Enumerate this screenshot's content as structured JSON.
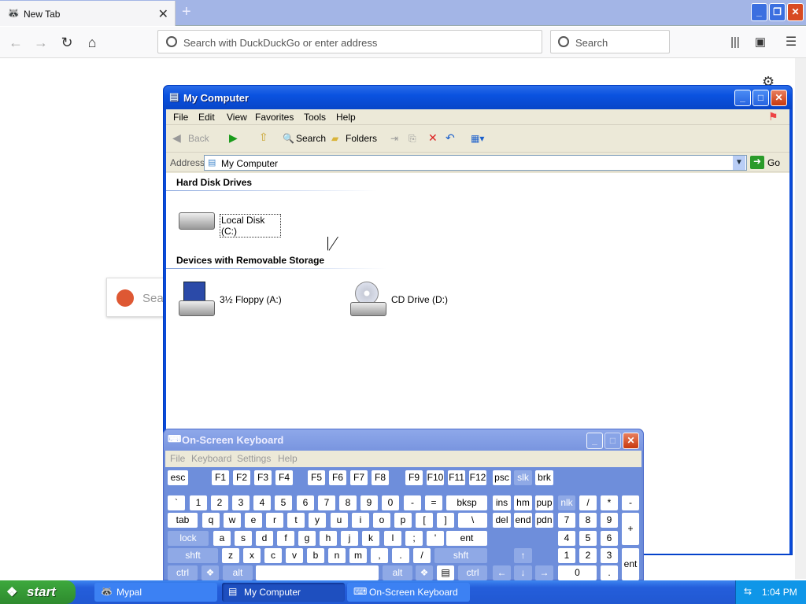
{
  "browser": {
    "tab_title": "New Tab",
    "url_placeholder": "Search with DuckDuckGo or enter address",
    "search_placeholder": "Search",
    "ddg_search_text": "Sea"
  },
  "mycomputer": {
    "title": "My Computer",
    "menu": [
      "File",
      "Edit",
      "View",
      "Favorites",
      "Tools",
      "Help"
    ],
    "toolbar": {
      "back": "Back",
      "search": "Search",
      "folders": "Folders"
    },
    "address_label": "Address",
    "address_value": "My Computer",
    "go_label": "Go",
    "groups": [
      {
        "name": "Hard Disk Drives",
        "items": [
          "Local Disk (C:)"
        ]
      },
      {
        "name": "Devices with Removable Storage",
        "items": [
          "3½ Floppy (A:)",
          "CD Drive (D:)"
        ]
      }
    ]
  },
  "osk": {
    "title": "On-Screen Keyboard",
    "menu": [
      "File",
      "Keyboard",
      "Settings",
      "Help"
    ],
    "keys": {
      "esc": "esc",
      "f": [
        "F1",
        "F2",
        "F3",
        "F4",
        "F5",
        "F6",
        "F7",
        "F8",
        "F9",
        "F10",
        "F11",
        "F12"
      ],
      "psc": "psc",
      "slk": "slk",
      "brk": "brk",
      "num_row": [
        "`",
        "1",
        "2",
        "3",
        "4",
        "5",
        "6",
        "7",
        "8",
        "9",
        "0",
        "-",
        "="
      ],
      "bksp": "bksp",
      "ins": "ins",
      "hm": "hm",
      "pup": "pup",
      "nlk": "nlk",
      "np_r1": [
        "/",
        "*",
        "-"
      ],
      "tab": "tab",
      "q_row": [
        "q",
        "w",
        "e",
        "r",
        "t",
        "y",
        "u",
        "i",
        "o",
        "p",
        "[",
        "]",
        "\\"
      ],
      "del": "del",
      "end": "end",
      "pdn": "pdn",
      "np_r2": [
        "7",
        "8",
        "9"
      ],
      "plus": "+",
      "lock": "lock",
      "a_row": [
        "a",
        "s",
        "d",
        "f",
        "g",
        "h",
        "j",
        "k",
        "l",
        ";",
        "'"
      ],
      "ent": "ent",
      "np_r3": [
        "4",
        "5",
        "6"
      ],
      "shft": "shft",
      "z_row": [
        "z",
        "x",
        "c",
        "v",
        "b",
        "n",
        "m",
        ",",
        ".",
        "/"
      ],
      "np_r4": [
        "1",
        "2",
        "3"
      ],
      "ctrl": "ctrl",
      "alt": "alt",
      "np_0": "0",
      "np_dot": ".",
      "np_ent": "ent"
    }
  },
  "taskbar": {
    "start": "start",
    "items": [
      "Mypal",
      "My Computer",
      "On-Screen Keyboard"
    ],
    "clock": "1:04 PM"
  }
}
